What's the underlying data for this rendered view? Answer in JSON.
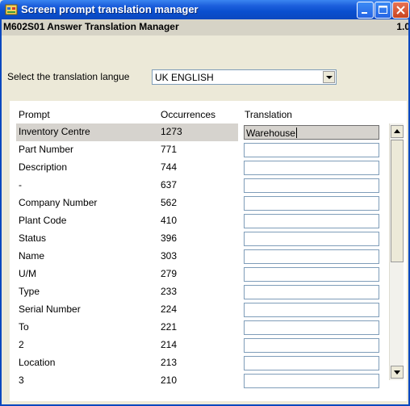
{
  "window": {
    "title": "Screen prompt translation manager",
    "form_title": "M602S01 Answer Translation Manager",
    "version": "1.0"
  },
  "language": {
    "label": "Select the translation langue",
    "value": "UK ENGLISH"
  },
  "columns": {
    "prompt": "Prompt",
    "occurrences": "Occurrences",
    "translation": "Translation"
  },
  "rows": [
    {
      "prompt": "Inventory Centre",
      "occurrences": "1273",
      "translation": "Warehouse"
    },
    {
      "prompt": "Part Number",
      "occurrences": "771",
      "translation": ""
    },
    {
      "prompt": "Description",
      "occurrences": "744",
      "translation": ""
    },
    {
      "prompt": "-",
      "occurrences": "637",
      "translation": ""
    },
    {
      "prompt": "Company Number",
      "occurrences": "562",
      "translation": ""
    },
    {
      "prompt": "Plant Code",
      "occurrences": "410",
      "translation": ""
    },
    {
      "prompt": "Status",
      "occurrences": "396",
      "translation": ""
    },
    {
      "prompt": "Name",
      "occurrences": "303",
      "translation": ""
    },
    {
      "prompt": "U/M",
      "occurrences": "279",
      "translation": ""
    },
    {
      "prompt": "Type",
      "occurrences": "233",
      "translation": ""
    },
    {
      "prompt": "Serial Number",
      "occurrences": "224",
      "translation": ""
    },
    {
      "prompt": "To",
      "occurrences": "221",
      "translation": ""
    },
    {
      "prompt": "2",
      "occurrences": "214",
      "translation": ""
    },
    {
      "prompt": "Location",
      "occurrences": "213",
      "translation": ""
    },
    {
      "prompt": "3",
      "occurrences": "210",
      "translation": ""
    }
  ],
  "icons": {
    "app": "app-window-icon",
    "minimize": "minimize-icon",
    "maximize": "maximize-icon",
    "close": "close-icon",
    "dropdown": "chevron-down-icon",
    "scroll_up": "scroll-up-arrow-icon",
    "scroll_down": "scroll-down-arrow-icon"
  },
  "colors": {
    "titlebar": "#0a4fcf",
    "window_bg": "#ece9d8",
    "selected_row": "#d6d3ce",
    "close_button": "#c8441f"
  }
}
